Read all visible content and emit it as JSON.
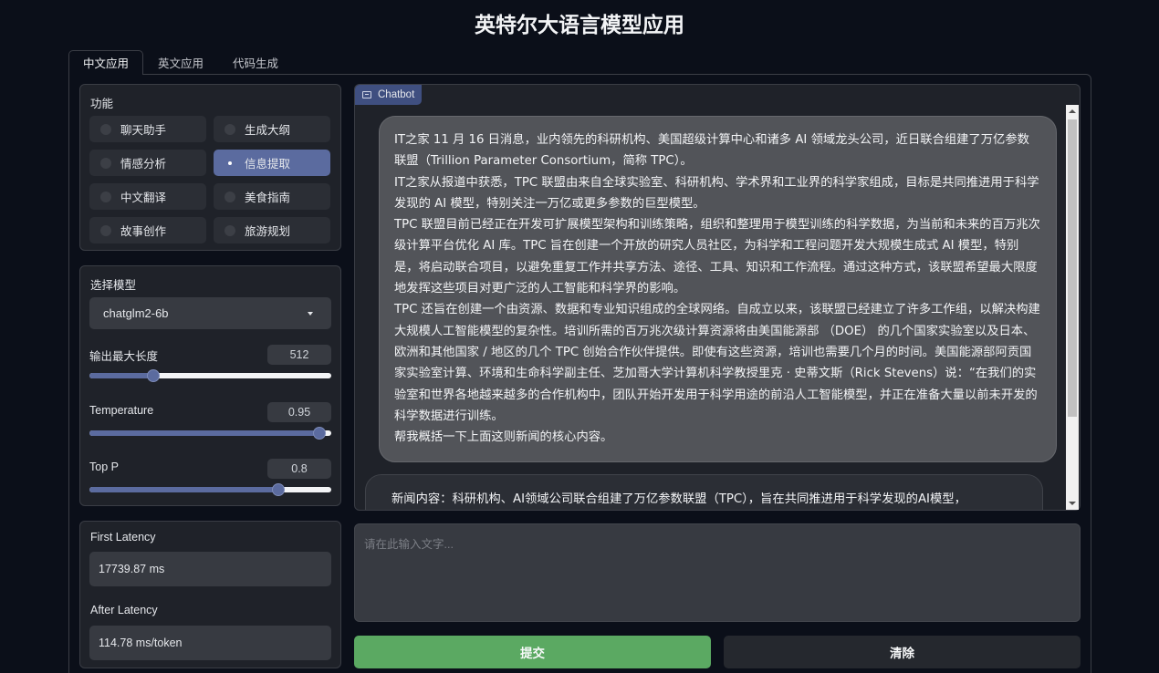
{
  "app": {
    "title": "英特尔大语言模型应用"
  },
  "tabs": [
    {
      "label": "中文应用",
      "active": true
    },
    {
      "label": "英文应用",
      "active": false
    },
    {
      "label": "代码生成",
      "active": false
    }
  ],
  "function_panel": {
    "label": "功能",
    "options": [
      {
        "label": "聊天助手",
        "selected": false
      },
      {
        "label": "生成大纲",
        "selected": false
      },
      {
        "label": "情感分析",
        "selected": false
      },
      {
        "label": "信息提取",
        "selected": true
      },
      {
        "label": "中文翻译",
        "selected": false
      },
      {
        "label": "美食指南",
        "selected": false
      },
      {
        "label": "故事创作",
        "selected": false
      },
      {
        "label": "旅游规划",
        "selected": false
      }
    ]
  },
  "model_panel": {
    "label": "选择模型",
    "selected_model": "chatglm2-6b",
    "sliders": [
      {
        "label": "输出最大长度",
        "value": "512",
        "fraction": 0.265
      },
      {
        "label": "Temperature",
        "value": "0.95",
        "fraction": 0.95
      },
      {
        "label": "Top P",
        "value": "0.8",
        "fraction": 0.78
      }
    ]
  },
  "latency": {
    "first_label": "First Latency",
    "first_value": "17739.87 ms",
    "after_label": "After Latency",
    "after_value": "114.78 ms/token"
  },
  "chatbot": {
    "label": "Chatbot",
    "icon": "chat-icon",
    "user_message": [
      "IT之家 11 月 16 日消息，业内领先的科研机构、美国超级计算中心和诸多 AI 领域龙头公司，近日联合组建了万亿参数联盟（Trillion Parameter Consortium，简称 TPC）。",
      "IT之家从报道中获悉，TPC 联盟由来自全球实验室、科研机构、学术界和工业界的科学家组成，目标是共同推进用于科学发现的 AI 模型，特别关注一万亿或更多参数的巨型模型。",
      "TPC 联盟目前已经正在开发可扩展模型架构和训练策略，组织和整理用于模型训练的科学数据，为当前和未来的百万兆次级计算平台优化 AI 库。TPC 旨在创建一个开放的研究人员社区，为科学和工程问题开发大规模生成式 AI 模型，特别是，将启动联合项目，以避免重复工作并共享方法、途径、工具、知识和工作流程。通过这种方式，该联盟希望最大限度地发挥这些项目对更广泛的人工智能和科学界的影响。",
      "TPC 还旨在创建一个由资源、数据和专业知识组成的全球网络。自成立以来，该联盟已经建立了许多工作组，以解决构建大规模人工智能模型的复杂性。培训所需的百万兆次级计算资源将由美国能源部 （DOE） 的几个国家实验室以及日本、欧洲和其他国家 / 地区的几个 TPC 创始合作伙伴提供。即使有这些资源，培训也需要几个月的时间。美国能源部阿贡国家实验室计算、环境和生命科学副主任、芝加哥大学计算机科学教授里克 · 史蒂文斯（Rick Stevens）说：“在我们的实验室和世界各地越来越多的合作机构中，团队开始开发用于科学用途的前沿人工智能模型，并正在准备大量以前未开发的科学数据进行训练。",
      "帮我概括一下上面这则新闻的核心内容。"
    ],
    "bot_message": "新闻内容：科研机构、AI领域公司联合组建了万亿参数联盟（TPC），旨在共同推进用于科学发现的AI模型，"
  },
  "input": {
    "placeholder": "请在此输入文字..."
  },
  "buttons": {
    "submit": "提交",
    "clear": "清除"
  },
  "colors": {
    "accent": "#5b6b9f",
    "submit": "#5ba962",
    "background": "#0b0f19"
  }
}
